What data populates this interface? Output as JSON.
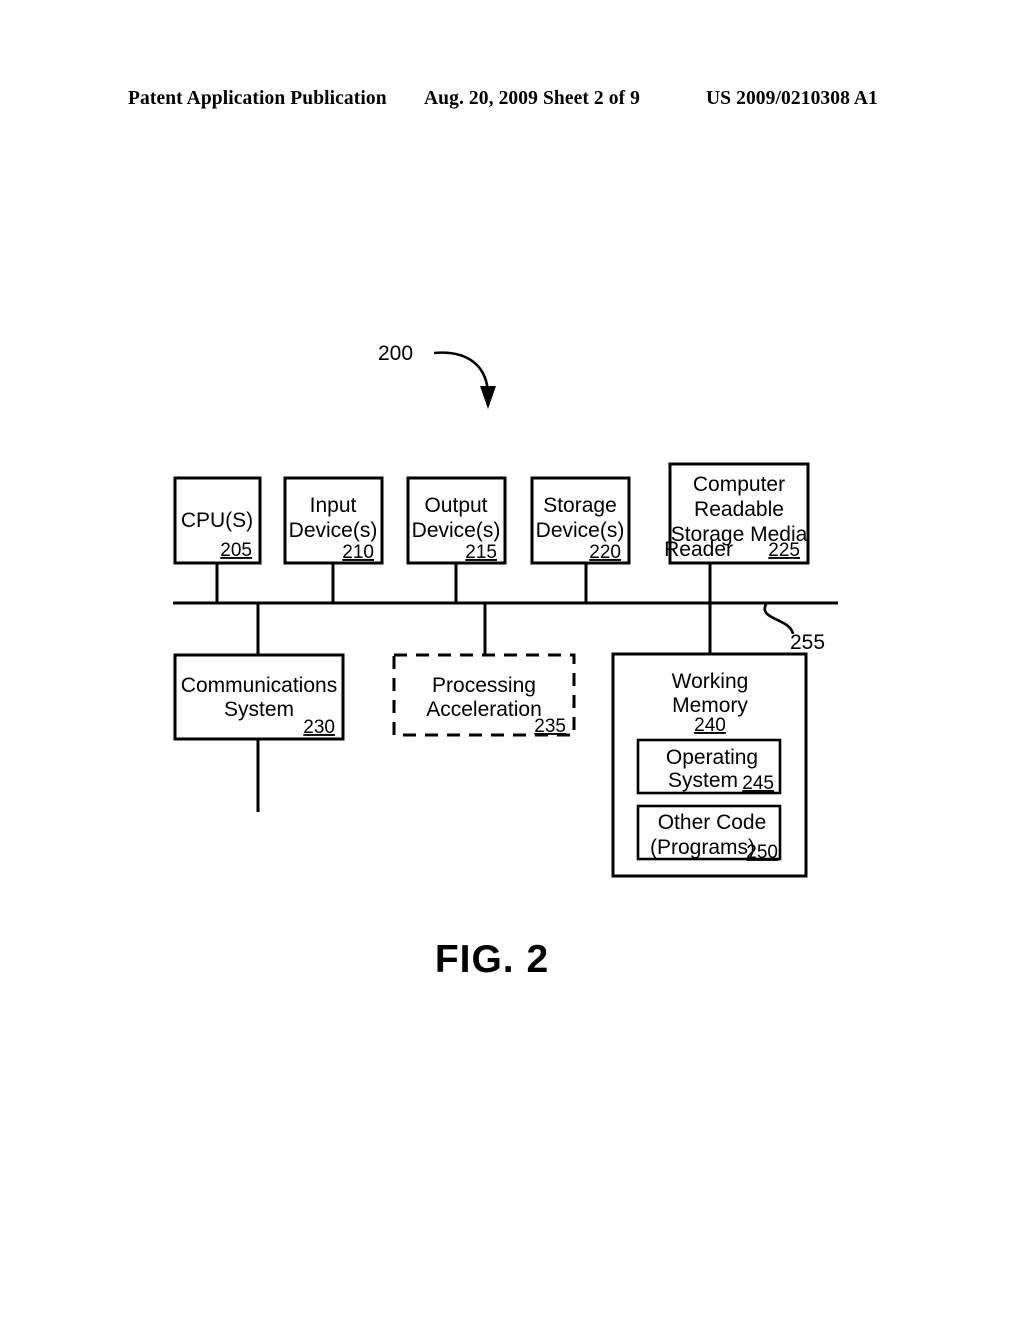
{
  "header": {
    "left": "Patent Application Publication",
    "middle": "Aug. 20, 2009  Sheet 2 of 9",
    "right": "US 2009/0210308 A1"
  },
  "figure": {
    "caption": "FIG. 2",
    "system_callout": "200",
    "bus_callout": "255"
  },
  "blocks": {
    "cpu": {
      "line1": "CPU(S)",
      "ref": "205"
    },
    "input_device": {
      "line1": "Input",
      "line2": "Device(s)",
      "ref": "210"
    },
    "output_device": {
      "line1": "Output",
      "line2": "Device(s)",
      "ref": "215"
    },
    "storage_device": {
      "line1": "Storage",
      "line2": "Device(s)",
      "ref": "220"
    },
    "media_reader": {
      "line1": "Computer",
      "line2": "Readable",
      "line3": "Storage Media",
      "line4": "Reader",
      "ref": "225"
    },
    "communications_system": {
      "line1": "Communications",
      "line2": "System",
      "ref": "230"
    },
    "processing_acceleration": {
      "line1": "Processing",
      "line2": "Acceleration",
      "ref": "235"
    },
    "working_memory": {
      "line1": "Working",
      "line2": "Memory",
      "ref": "240"
    },
    "operating_system": {
      "line1": "Operating",
      "line2": "System",
      "ref": "245"
    },
    "other_code": {
      "line1": "Other Code",
      "line2": "(Programs)",
      "ref": "250"
    }
  }
}
